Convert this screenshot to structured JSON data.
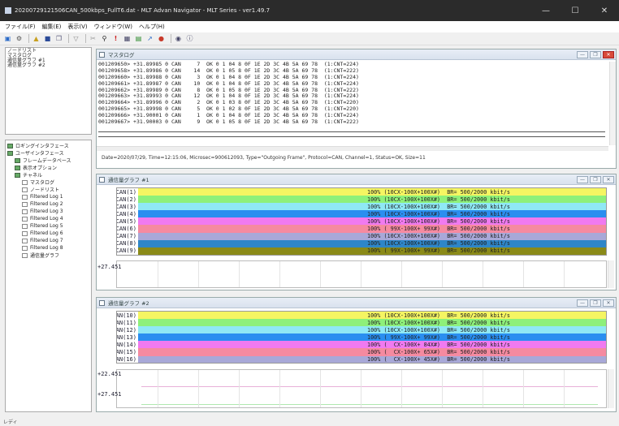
{
  "window": {
    "title": "20200729121506CAN_500kbps_FullT6.dat - MLT Advan Navigator - MLT Series - ver1.49.7"
  },
  "menu": [
    "ファイル(F)",
    "編集(E)",
    "表示(V)",
    "ウィンドウ(W)",
    "ヘルプ(H)"
  ],
  "toolbar_icons": [
    "new-icon",
    "settings-icon",
    "open-icon",
    "save-icon",
    "copy-icon",
    "filter-icon",
    "cut-icon",
    "search-icon",
    "alert-icon",
    "grid-icon",
    "graph-icon",
    "chart-icon",
    "signal-icon",
    "record-icon",
    "info-icon"
  ],
  "left_top": {
    "lines": [
      "ノードリスト",
      "マスタログ",
      "通信量グラフ #1",
      "通信量グラフ #2"
    ]
  },
  "tree": [
    {
      "label": "ロギングインタフェース",
      "level": 0,
      "icon": "g"
    },
    {
      "label": "ユーザインタフェース",
      "level": 0,
      "icon": "g"
    },
    {
      "label": "フレームデータベース",
      "level": 1,
      "icon": "g"
    },
    {
      "label": "表示オプション",
      "level": 1,
      "icon": "g"
    },
    {
      "label": "チャネル",
      "level": 1,
      "icon": "g"
    },
    {
      "label": "マスタログ",
      "level": 2,
      "icon": "d"
    },
    {
      "label": "ノードリスト",
      "level": 2,
      "icon": "d"
    },
    {
      "label": "Filtered Log 1",
      "level": 2,
      "icon": "d"
    },
    {
      "label": "Filtered Log 2",
      "level": 2,
      "icon": "d"
    },
    {
      "label": "Filtered Log 3",
      "level": 2,
      "icon": "d"
    },
    {
      "label": "Filtered Log 4",
      "level": 2,
      "icon": "d"
    },
    {
      "label": "Filtered Log 5",
      "level": 2,
      "icon": "d"
    },
    {
      "label": "Filtered Log 6",
      "level": 2,
      "icon": "d"
    },
    {
      "label": "Filtered Log 7",
      "level": 2,
      "icon": "d"
    },
    {
      "label": "Filtered Log 8",
      "level": 2,
      "icon": "d"
    },
    {
      "label": "通信量グラフ",
      "level": 2,
      "icon": "d"
    }
  ],
  "master_log": {
    "title": "マスタログ",
    "rows": [
      "001209650> +31.89985 0 CAN     7  OK 0 1 04 8 0F 1E 2D 3C 4B 5A 69 78  (1:CNT=224)",
      "001209658> +31.89986 0 CAN    14  OK 0 1 05 8 0F 1E 2D 3C 4B 5A 69 78  (1:CNT=222)",
      "001209660> +31.89988 0 CAN     3  OK 0 1 04 8 0F 1E 2D 3C 4B 5A 69 78  (1:CNT=224)",
      "001209661> +31.89987 0 CAN    10  OK 0 1 04 8 0F 1E 2D 3C 4B 5A 69 78  (1:CNT=224)",
      "001209662> +31.89989 0 CAN     8  OK 0 1 05 8 0F 1E 2D 3C 4B 5A 69 78  (1:CNT=222)",
      "001209663> +31.89993 0 CAN    12  OK 0 1 04 8 0F 1E 2D 3C 4B 5A 69 78  (1:CNT=224)",
      "001209664> +31.89996 0 CAN     2  OK 0 1 03 8 0F 1E 2D 3C 4B 5A 69 78  (1:CNT=220)",
      "001209665> +31.89998 0 CAN     5  OK 0 1 02 8 0F 1E 2D 3C 4B 5A 69 78  (1:CNT=220)",
      "001209666> +31.90001 0 CAN     1  OK 0 1 04 8 0F 1E 2D 3C 4B 5A 69 78  (1:CNT=224)",
      "001209667> +31.90003 0 CAN     9  OK 0 1 05 8 0F 1E 2D 3C 4B 5A 69 78  (1:CNT=222)"
    ],
    "status": "Date=2020/07/29, Time=12:15:06, Microsec=900612093, Type=\"Outgoing Frame\", Protocol=CAN, Channel=1, Status=OK, Size=11"
  },
  "graph1": {
    "title": "通信量グラフ #1",
    "channels": [
      {
        "name": "CAN(1)",
        "text": "100% (10CX-100X+100X#)  BR= 500/2000 kbit/s",
        "color": "#f5f562"
      },
      {
        "name": "CAN(2)",
        "text": "100% (10CX-100X+100X#)  BR= 500/2000 kbit/s",
        "color": "#8ef07a"
      },
      {
        "name": "CAN(3)",
        "text": "100% (10CX-100X+100X#)  BR= 500/2000 kbit/s",
        "color": "#8fe8f5"
      },
      {
        "name": "CAN(4)",
        "text": "100% (10CX-100X+100X#)  BR= 500/2000 kbit/s",
        "color": "#2a8ef0"
      },
      {
        "name": "CAN(5)",
        "text": "100% (10CX-100X+100X#)  BR= 500/2000 kbit/s",
        "color": "#f07af0"
      },
      {
        "name": "CAN(6)",
        "text": "100% ( 99X-100X+ 99X#)  BR= 500/2000 kbit/s",
        "color": "#f58aa0"
      },
      {
        "name": "CAN(7)",
        "text": "100% (10CX-100X+100X#)  BR= 500/2000 kbit/s",
        "color": "#a8a8d8"
      },
      {
        "name": "CAN(8)",
        "text": "100% (10CX-100X+100X#)  BR= 500/2000 kbit/s",
        "color": "#2e86c8"
      },
      {
        "name": "CAN(9)",
        "text": "100% ( 99X-100X+ 99X#)  BR= 500/2000 kbit/s",
        "color": "#8a8a18"
      }
    ],
    "yvalue": "+27.451"
  },
  "graph2": {
    "title": "通信量グラフ #2",
    "channels": [
      {
        "name": "CAN(10)",
        "text": "100% (10CX-100X+100X#)  BR= 500/2000 kbit/s",
        "color": "#f5f562"
      },
      {
        "name": "CAN(11)",
        "text": "100% (10CX-100X+100X#)  BR= 500/2000 kbit/s",
        "color": "#8ef07a"
      },
      {
        "name": "CAN(12)",
        "text": "100% (10CX-100X+100X#)  BR= 500/2000 kbit/s",
        "color": "#8fe8f5"
      },
      {
        "name": "CAN(13)",
        "text": "100% ( 99X-100X+ 99X#)  BR= 500/2000 kbit/s",
        "color": "#2a8ef0"
      },
      {
        "name": "CAN(14)",
        "text": "100% (  CX-100X+ 84X#)  BR= 500/2000 kbit/s",
        "color": "#f07af0"
      },
      {
        "name": "CAN(15)",
        "text": "100% (  CX-100X+ 65X#)  BR= 500/2000 kbit/s",
        "color": "#f58aa0"
      },
      {
        "name": "CAN(16)",
        "text": "100% (  CX-100X+ 45X#)  BR= 500/2000 kbit/s",
        "color": "#a8a8d8"
      }
    ],
    "yvalue1": "+22.451",
    "yvalue2": "+27.451"
  },
  "statusbar": "レディ"
}
